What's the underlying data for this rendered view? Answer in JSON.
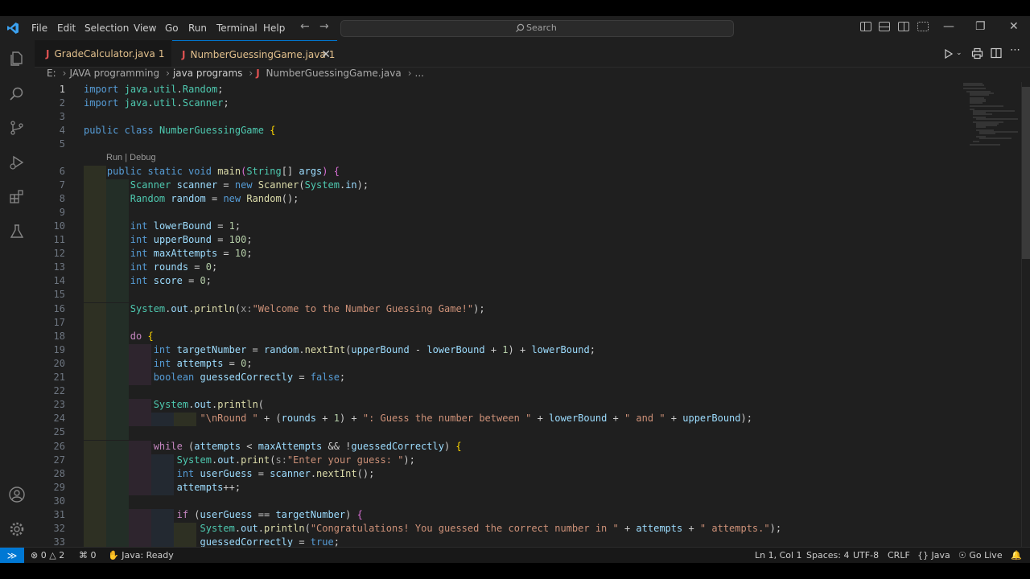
{
  "titlebar": {
    "menus": [
      "File",
      "Edit",
      "Selection",
      "View",
      "Go",
      "Run",
      "Terminal",
      "Help"
    ],
    "search_placeholder": "Search",
    "accent": "#0078d4"
  },
  "tabs": [
    {
      "label": "GradeCalculator.java",
      "badge": "1",
      "active": false
    },
    {
      "label": "NumberGuessingGame.java",
      "badge": "1",
      "active": true
    }
  ],
  "breadcrumb": [
    "E:",
    "JAVA programming",
    "java programs",
    "NumberGuessingGame.java",
    "..."
  ],
  "editor": {
    "codelens": "Run | Debug",
    "lines": [
      {
        "n": "1",
        "html": "<span class=\"k\">import</span> <span class=\"t\">java</span>.<span class=\"t\">util</span>.<span class=\"t\">Random</span>;"
      },
      {
        "n": "2",
        "html": "<span class=\"k\">import</span> <span class=\"t\">java</span>.<span class=\"t\">util</span>.<span class=\"t\">Scanner</span>;"
      },
      {
        "n": "3",
        "html": ""
      },
      {
        "n": "4",
        "html": "<span class=\"k\">public class</span> <span class=\"t\">NumberGuessingGame</span> <span class=\"p\">{</span>"
      },
      {
        "n": "5",
        "html": ""
      },
      {
        "n": "6",
        "html": "    <span class=\"k\">public static void</span> <span class=\"f\">main</span><span class=\"f2\">(</span><span class=\"t\">String</span>[] <span class=\"v\">args</span><span class=\"f2\">)</span> <span class=\"f2\">{</span>"
      },
      {
        "n": "7",
        "html": "        <span class=\"t\">Scanner</span> <span class=\"v\">scanner</span> = <span class=\"k\">new</span> <span class=\"f\">Scanner</span>(<span class=\"t\">System</span>.<span class=\"v\">in</span>);"
      },
      {
        "n": "8",
        "html": "        <span class=\"t\">Random</span> <span class=\"v\">random</span> = <span class=\"k\">new</span> <span class=\"f\">Random</span>();"
      },
      {
        "n": "9",
        "html": ""
      },
      {
        "n": "10",
        "html": "        <span class=\"k\">int</span> <span class=\"v\">lowerBound</span> = <span class=\"n\">1</span>;"
      },
      {
        "n": "11",
        "html": "        <span class=\"k\">int</span> <span class=\"v\">upperBound</span> = <span class=\"n\">100</span>;"
      },
      {
        "n": "12",
        "html": "        <span class=\"k\">int</span> <span class=\"v\">maxAttempts</span> = <span class=\"n\">10</span>;"
      },
      {
        "n": "13",
        "html": "        <span class=\"k\">int</span> <span class=\"v\">rounds</span> = <span class=\"n\">0</span>;"
      },
      {
        "n": "14",
        "html": "        <span class=\"k\">int</span> <span class=\"v\">score</span> = <span class=\"n\">0</span>;"
      },
      {
        "n": "15",
        "html": ""
      },
      {
        "n": "16",
        "html": "        <span class=\"t\">System</span>.<span class=\"v\">out</span>.<span class=\"f\">println</span>(<span class=\"h\">x:</span><span class=\"s\">\"Welcome to the Number Guessing Game!\"</span>);"
      },
      {
        "n": "17",
        "html": ""
      },
      {
        "n": "18",
        "html": "        <span class=\"c\">do</span> <span class=\"p\">{</span>"
      },
      {
        "n": "19",
        "html": "            <span class=\"k\">int</span> <span class=\"v\">targetNumber</span> = <span class=\"v\">random</span>.<span class=\"f\">nextInt</span>(<span class=\"v\">upperBound</span> - <span class=\"v\">lowerBound</span> + <span class=\"n\">1</span>) + <span class=\"v\">lowerBound</span>;"
      },
      {
        "n": "20",
        "html": "            <span class=\"k\">int</span> <span class=\"v\">attempts</span> = <span class=\"n\">0</span>;"
      },
      {
        "n": "21",
        "html": "            <span class=\"k\">boolean</span> <span class=\"v\">guessedCorrectly</span> = <span class=\"k\">false</span>;"
      },
      {
        "n": "22",
        "html": ""
      },
      {
        "n": "23",
        "html": "            <span class=\"t\">System</span>.<span class=\"v\">out</span>.<span class=\"f\">println</span>("
      },
      {
        "n": "24",
        "html": "                    <span class=\"s\">\"\\nRound \"</span> + (<span class=\"v\">rounds</span> + <span class=\"n\">1</span>) + <span class=\"s\">\": Guess the number between \"</span> + <span class=\"v\">lowerBound</span> + <span class=\"s\">\" and \"</span> + <span class=\"v\">upperBound</span>);"
      },
      {
        "n": "25",
        "html": ""
      },
      {
        "n": "26",
        "html": "            <span class=\"c\">while</span> (<span class=\"v\">attempts</span> &lt; <span class=\"v\">maxAttempts</span> &amp;&amp; !<span class=\"v\">guessedCorrectly</span>) <span class=\"p\">{</span>"
      },
      {
        "n": "27",
        "html": "                <span class=\"t\">System</span>.<span class=\"v\">out</span>.<span class=\"f\">print</span>(<span class=\"h\">s:</span><span class=\"s\">\"Enter your guess: \"</span>);"
      },
      {
        "n": "28",
        "html": "                <span class=\"k\">int</span> <span class=\"v\">userGuess</span> = <span class=\"v\">scanner</span>.<span class=\"f\">nextInt</span>();"
      },
      {
        "n": "29",
        "html": "                <span class=\"v\">attempts</span>++;"
      },
      {
        "n": "30",
        "html": ""
      },
      {
        "n": "31",
        "html": "                <span class=\"c\">if</span> (<span class=\"v\">userGuess</span> == <span class=\"v\">targetNumber</span>) <span class=\"f2\">{</span>"
      },
      {
        "n": "32",
        "html": "                    <span class=\"t\">System</span>.<span class=\"v\">out</span>.<span class=\"f\">println</span>(<span class=\"s\">\"Congratulations! You guessed the correct number in \"</span> + <span class=\"v\">attempts</span> + <span class=\"s\">\" attempts.\"</span>);"
      },
      {
        "n": "33",
        "html": "                    <span class=\"v\">guessedCorrectly</span> = <span class=\"k\">true</span>;"
      }
    ]
  },
  "statusbar": {
    "errors": "0",
    "warnings": "2",
    "ports": "0",
    "java_status": "Java: Ready",
    "cursor": "Ln 1, Col 1",
    "spaces": "Spaces: 4",
    "encoding": "UTF-8",
    "eol": "CRLF",
    "language": "Java",
    "golive": "Go Live"
  }
}
